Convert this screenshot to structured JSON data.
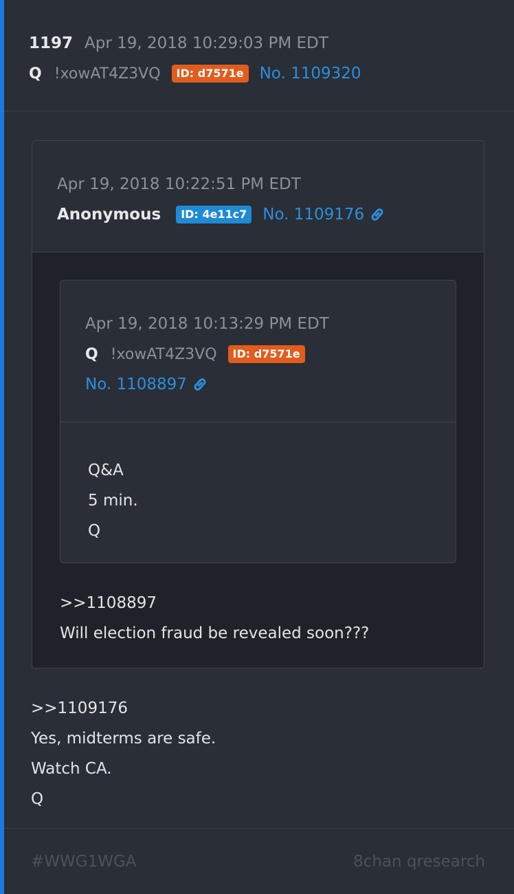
{
  "post": {
    "number": "1197",
    "date": "Apr 19, 2018 10:29:03 PM EDT",
    "name": "Q",
    "tripcode": "!xowAT4Z3VQ",
    "id_badge": "ID: d7571e",
    "post_no": "No. 1109320",
    "body": [
      ">>1109176",
      "Yes, midterms are safe.",
      "Watch CA.",
      "Q"
    ]
  },
  "quoted": {
    "date": "Apr 19, 2018 10:22:51 PM EDT",
    "name": "Anonymous",
    "id_badge": "ID: 4e11c7",
    "post_no": "No. 1109176",
    "body": [
      ">>1108897",
      "Will election fraud be revealed soon???"
    ],
    "nested": {
      "date": "Apr 19, 2018 10:13:29 PM EDT",
      "name": "Q",
      "tripcode": "!xowAT4Z3VQ",
      "id_badge": "ID: d7571e",
      "post_no": "No. 1108897",
      "body": [
        "Q&A",
        "5 min.",
        "Q"
      ]
    }
  },
  "footer": {
    "hashtag": "#WWG1WGA",
    "source": "8chan qresearch"
  },
  "icons": {
    "link": "link-icon"
  },
  "colors": {
    "accent_bar": "#1a7ae2",
    "link": "#2b8fde",
    "badge_q": "#e25c1d",
    "badge_anon": "#1f8ad6"
  }
}
